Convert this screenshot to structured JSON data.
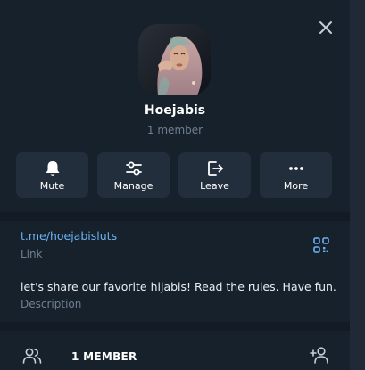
{
  "profile": {
    "name": "Hoejabis",
    "members": "1 member"
  },
  "actions": [
    {
      "label": "Mute",
      "icon": "bell-icon"
    },
    {
      "label": "Manage",
      "icon": "sliders-icon"
    },
    {
      "label": "Leave",
      "icon": "leave-icon"
    },
    {
      "label": "More",
      "icon": "more-icon"
    }
  ],
  "info": {
    "link": "t.me/hoejabisluts",
    "link_label": "Link",
    "description": "let's share our favorite hijabis! Read the rules. Have fun.",
    "description_label": "Description"
  },
  "members_section": {
    "title": "1 MEMBER"
  },
  "colors": {
    "panel": "#17212b",
    "button": "#232e3c",
    "link": "#6ab3f3",
    "muted": "#6f7f8f",
    "divider": "#131b24"
  }
}
